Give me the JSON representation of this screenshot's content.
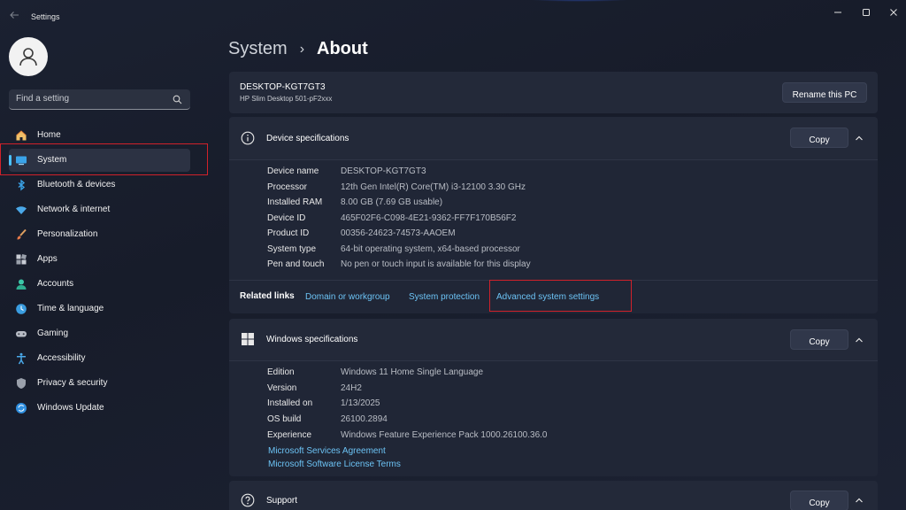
{
  "app": {
    "title": "Settings"
  },
  "search": {
    "placeholder": "Find a setting"
  },
  "sidebar": {
    "items": [
      {
        "label": "Home"
      },
      {
        "label": "System"
      },
      {
        "label": "Bluetooth & devices"
      },
      {
        "label": "Network & internet"
      },
      {
        "label": "Personalization"
      },
      {
        "label": "Apps"
      },
      {
        "label": "Accounts"
      },
      {
        "label": "Time & language"
      },
      {
        "label": "Gaming"
      },
      {
        "label": "Accessibility"
      },
      {
        "label": "Privacy & security"
      },
      {
        "label": "Windows Update"
      }
    ]
  },
  "breadcrumb": {
    "parent": "System",
    "separator": "›",
    "current": "About"
  },
  "device_header": {
    "name": "DESKTOP-KGT7GT3",
    "model": "HP Slim Desktop 501-pF2xxx",
    "rename_label": "Rename this PC"
  },
  "device_specs": {
    "title": "Device specifications",
    "copy_label": "Copy",
    "rows": [
      {
        "label": "Device name",
        "value": "DESKTOP-KGT7GT3"
      },
      {
        "label": "Processor",
        "value": "12th Gen Intel(R) Core(TM) i3-12100   3.30 GHz"
      },
      {
        "label": "Installed RAM",
        "value": "8.00 GB (7.69 GB usable)"
      },
      {
        "label": "Device ID",
        "value": "465F02F6-C098-4E21-9362-FF7F170B56F2"
      },
      {
        "label": "Product ID",
        "value": "00356-24623-74573-AAOEM"
      },
      {
        "label": "System type",
        "value": "64-bit operating system, x64-based processor"
      },
      {
        "label": "Pen and touch",
        "value": "No pen or touch input is available for this display"
      }
    ]
  },
  "related_links": {
    "label": "Related links",
    "links": [
      "Domain or workgroup",
      "System protection",
      "Advanced system settings"
    ]
  },
  "windows_specs": {
    "title": "Windows specifications",
    "copy_label": "Copy",
    "rows": [
      {
        "label": "Edition",
        "value": "Windows 11 Home Single Language"
      },
      {
        "label": "Version",
        "value": "24H2"
      },
      {
        "label": "Installed on",
        "value": "1/13/2025"
      },
      {
        "label": "OS build",
        "value": "26100.2894"
      },
      {
        "label": "Experience",
        "value": "Windows Feature Experience Pack 1000.26100.36.0"
      }
    ],
    "links": [
      "Microsoft Services Agreement",
      "Microsoft Software License Terms"
    ]
  },
  "support": {
    "title": "Support",
    "copy_label": "Copy"
  },
  "colors": {
    "accent": "#4cc2ff",
    "link": "#6cc3f5",
    "highlight": "#d0212a"
  }
}
